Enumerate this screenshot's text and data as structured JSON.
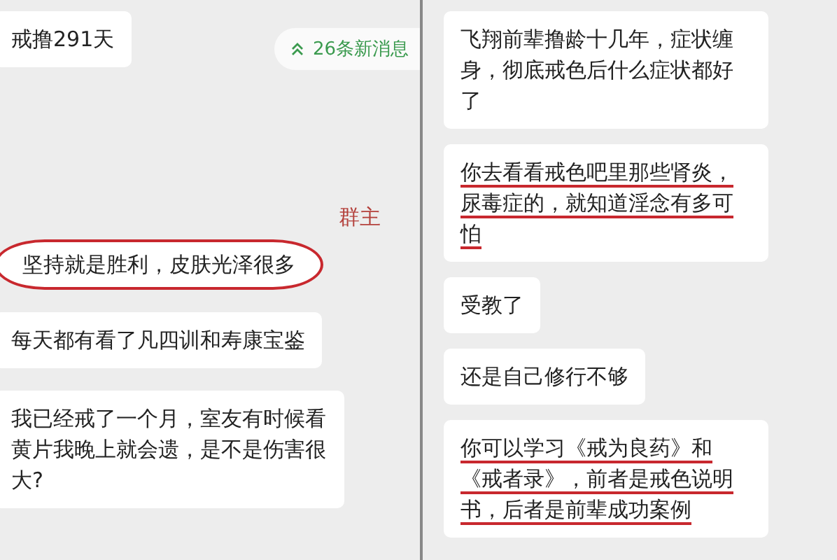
{
  "left_panel": {
    "first_message": {
      "text": "戒撸291天"
    },
    "new_messages": {
      "label": "26条新消息"
    },
    "annotation": {
      "text": "群主"
    },
    "messages": [
      {
        "text": "坚持就是胜利，皮肤光泽很多",
        "circled": true
      },
      {
        "text": "每天都有看了凡四训和寿康宝鉴",
        "circled": false
      },
      {
        "text": "我已经戒了一个月，室友有时候看黄片我晚上就会遗，是不是伤害很大?",
        "circled": false
      }
    ]
  },
  "right_panel": {
    "messages": [
      {
        "text": "飞翔前辈撸龄十几年，症状缠身，彻底戒色后什么症状都好了",
        "underlined": false
      },
      {
        "text": "你去看看戒色吧里那些肾炎，尿毒症的，就知道淫念有多可怕",
        "underlined": true
      },
      {
        "text": "受教了",
        "underlined": false
      },
      {
        "text": "还是自己修行不够",
        "underlined": false
      },
      {
        "text": "你可以学习《戒为良药》和《戒者录》，前者是戒色说明书，后者是前辈成功案例",
        "underlined": true
      }
    ]
  }
}
